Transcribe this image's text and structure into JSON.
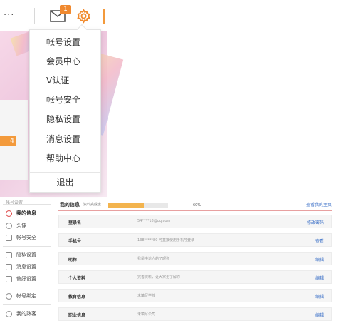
{
  "header": {
    "ellipsis": "...",
    "mail_badge": "1",
    "accent_color": "#f39a3c"
  },
  "banner": {
    "tag": "4"
  },
  "dropdown": {
    "items": [
      {
        "label": "帐号设置"
      },
      {
        "label": "会员中心"
      },
      {
        "label": "V认证"
      },
      {
        "label": "帐号安全"
      },
      {
        "label": "隐私设置"
      },
      {
        "label": "消息设置"
      },
      {
        "label": "帮助中心"
      }
    ],
    "logout": "退出"
  },
  "sidebar": {
    "title": "帐号设置",
    "items": [
      {
        "label": "我的信息",
        "icon": "user-icon"
      },
      {
        "label": "头像",
        "icon": "avatar-icon"
      },
      {
        "label": "帐号安全",
        "icon": "shield-icon"
      },
      {
        "label": "隐私设置",
        "icon": "lock-icon"
      },
      {
        "label": "消息设置",
        "icon": "message-icon"
      },
      {
        "label": "偏好设置",
        "icon": "preference-icon"
      },
      {
        "label": "帐号绑定",
        "icon": "link-icon"
      },
      {
        "label": "我的熟客",
        "icon": "user-icon"
      }
    ]
  },
  "main": {
    "title": "我的信息",
    "subtitle": "资料完成度",
    "progress": {
      "value": 60,
      "label": "60%"
    },
    "top_link": "查看我的主页",
    "rows": [
      {
        "label": "登录名",
        "value": "54****18@qq.com",
        "action": "修改密码"
      },
      {
        "label": "手机号",
        "value": "138*****80 可直接使用手机号登录",
        "action": "查看"
      },
      {
        "label": "昵称",
        "value": "我是中途人的了昵称",
        "action": "编辑"
      },
      {
        "label": "个人资料",
        "value": "完善资料，让大家更了解你",
        "action": "编辑"
      },
      {
        "label": "教育信息",
        "value": "未填写学校",
        "action": "编辑"
      },
      {
        "label": "职业信息",
        "value": "未填写公司",
        "action": "编辑"
      }
    ]
  }
}
